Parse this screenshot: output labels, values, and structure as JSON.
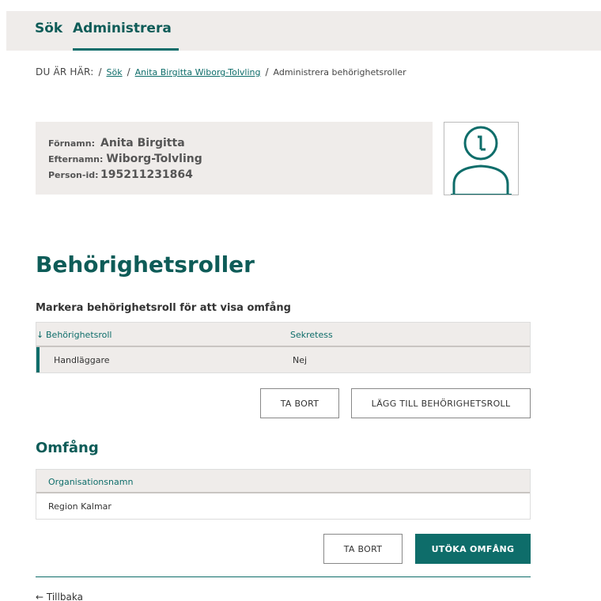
{
  "nav": {
    "items": [
      {
        "label": "Sök"
      },
      {
        "label": "Administrera"
      }
    ]
  },
  "breadcrumb": {
    "lead": "DU ÄR HÄR:",
    "separator": "/",
    "items": [
      {
        "label": "Sök"
      },
      {
        "label": "Anita Birgitta Wiborg-Tolvling"
      },
      {
        "label": "Administrera behörighetsroller"
      }
    ]
  },
  "person": {
    "first_name_label": "Förnamn:",
    "first_name": "Anita Birgitta",
    "last_name_label": "Efternamn:",
    "last_name": "Wiborg-Tolvling",
    "person_id_label": "Person-id:",
    "person_id": "195211231864"
  },
  "avatar_icon": "person-avatar-icon",
  "page_title": "Behörighetsroller",
  "roles": {
    "subtitle": "Markera behörighetsroll för att visa omfång",
    "sort_icon": "↓",
    "columns": [
      "Behörighetsroll",
      "Sekretess"
    ],
    "rows": [
      {
        "role": "Handläggare",
        "secrecy": "Nej"
      }
    ],
    "remove_label": "TA BORT",
    "add_label": "LÄGG TILL BEHÖRIGHETSROLL"
  },
  "scope": {
    "title": "Omfång",
    "columns": [
      "Organisationsnamn"
    ],
    "rows": [
      {
        "name": "Region Kalmar"
      }
    ],
    "remove_label": "TA BORT",
    "extend_label": "UTÖKA OMFÅNG"
  },
  "back": {
    "arrow": "←",
    "label": "Tillbaka"
  },
  "colors": {
    "accent": "#0e6d6a",
    "panel": "#efecea"
  }
}
